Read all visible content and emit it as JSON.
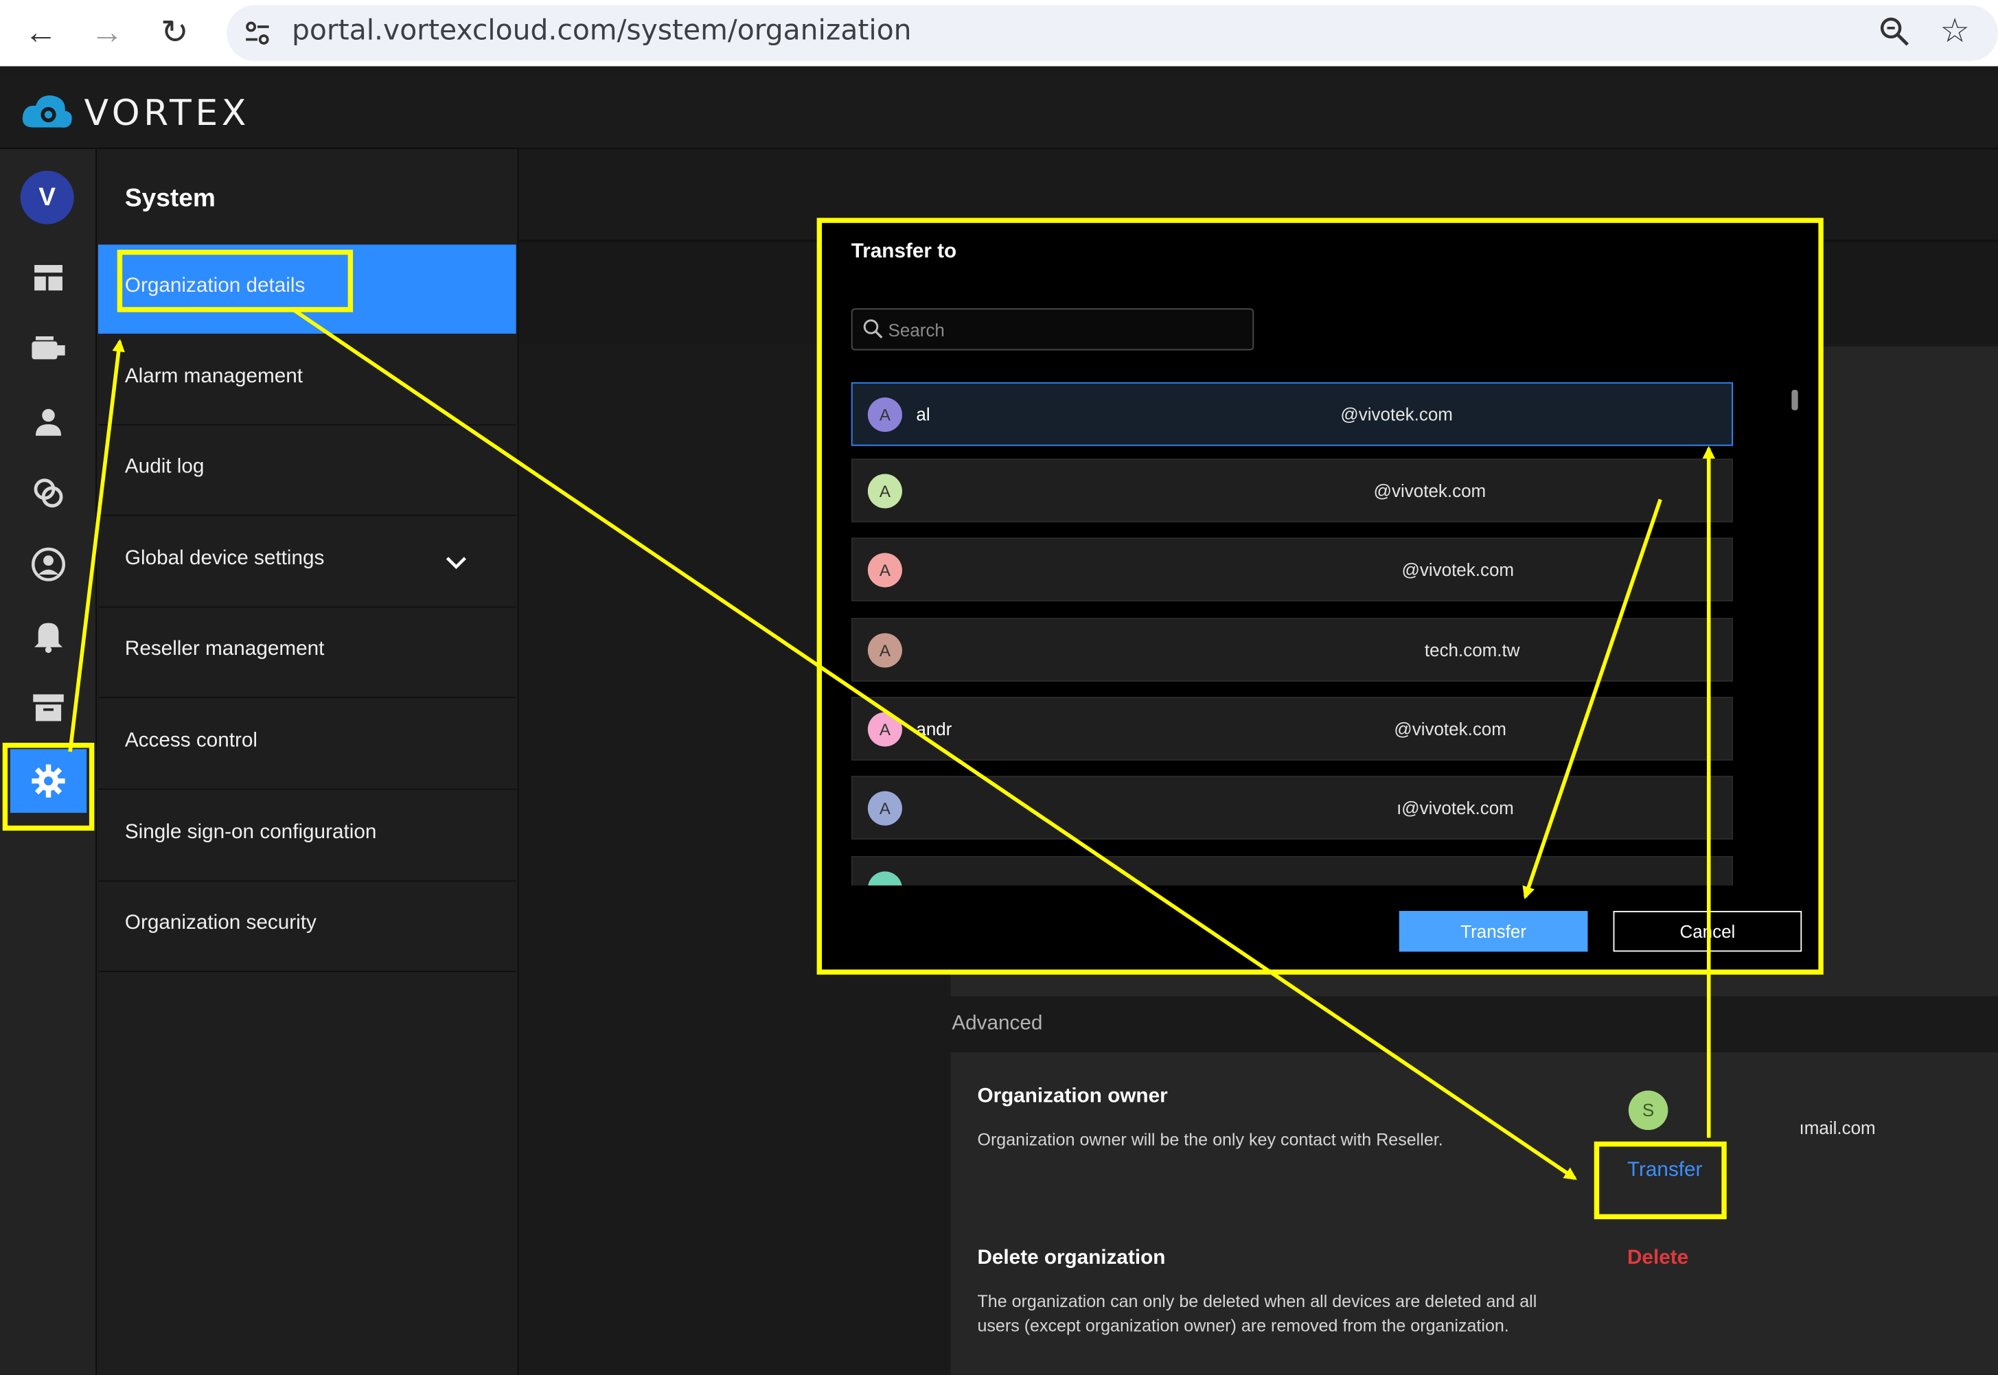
{
  "browser": {
    "url": "portal.vortexcloud.com/system/organization",
    "icons": [
      "back-arrow-icon",
      "forward-arrow-icon",
      "reload-icon",
      "site-settings-icon",
      "zoom-icon",
      "bookmark-star-icon"
    ]
  },
  "app": {
    "logo_text": "VORTEX"
  },
  "rail": {
    "avatar_letter": "V",
    "icons": [
      "dashboard-icon",
      "camera-icon",
      "user-icon",
      "share-icon",
      "account-circle-icon",
      "bell-icon",
      "archive-icon",
      "gear-icon"
    ]
  },
  "system": {
    "title": "System",
    "menu": [
      {
        "label": "Organization details"
      },
      {
        "label": "Alarm management"
      },
      {
        "label": "Audit log"
      },
      {
        "label": "Global device settings"
      },
      {
        "label": "Reseller management"
      },
      {
        "label": "Access control"
      },
      {
        "label": "Single sign-on configuration"
      },
      {
        "label": "Organization security"
      }
    ]
  },
  "modal": {
    "title": "Transfer to",
    "search_placeholder": "Search",
    "rows": [
      {
        "initial": "A",
        "name": "al",
        "email": "@vivotek.com",
        "color": "#8c83d9"
      },
      {
        "initial": "A",
        "name": "",
        "email": "@vivotek.com",
        "color": "#c5e6a6"
      },
      {
        "initial": "A",
        "name": "",
        "email": "@vivotek.com",
        "color": "#f4a3a3"
      },
      {
        "initial": "A",
        "name": "",
        "email": "tech.com.tw",
        "color": "#c79a8e"
      },
      {
        "initial": "A",
        "name": "andr",
        "email": "@vivotek.com",
        "color": "#f7a8d0"
      },
      {
        "initial": "A",
        "name": "",
        "email": "ı@vivotek.com",
        "color": "#9aa8d6"
      },
      {
        "initial": "",
        "name": "",
        "email": "",
        "color": "#6fd3b5"
      }
    ],
    "transfer_label": "Transfer",
    "cancel_label": "Cancel"
  },
  "advanced": {
    "label": "Advanced",
    "owner_title": "Organization owner",
    "owner_desc": "Organization owner will be the only key contact with Reseller.",
    "owner_initial": "S",
    "owner_email": "ımail.com",
    "transfer_link": "Transfer",
    "delete_title": "Delete organization",
    "delete_desc": "The organization can only be deleted when all devices are deleted and all users (except organization owner) are removed from the organization.",
    "delete_link": "Delete"
  },
  "colors": {
    "accent": "#2d8cff",
    "annotation": "#ffff00",
    "danger": "#e0393e"
  }
}
